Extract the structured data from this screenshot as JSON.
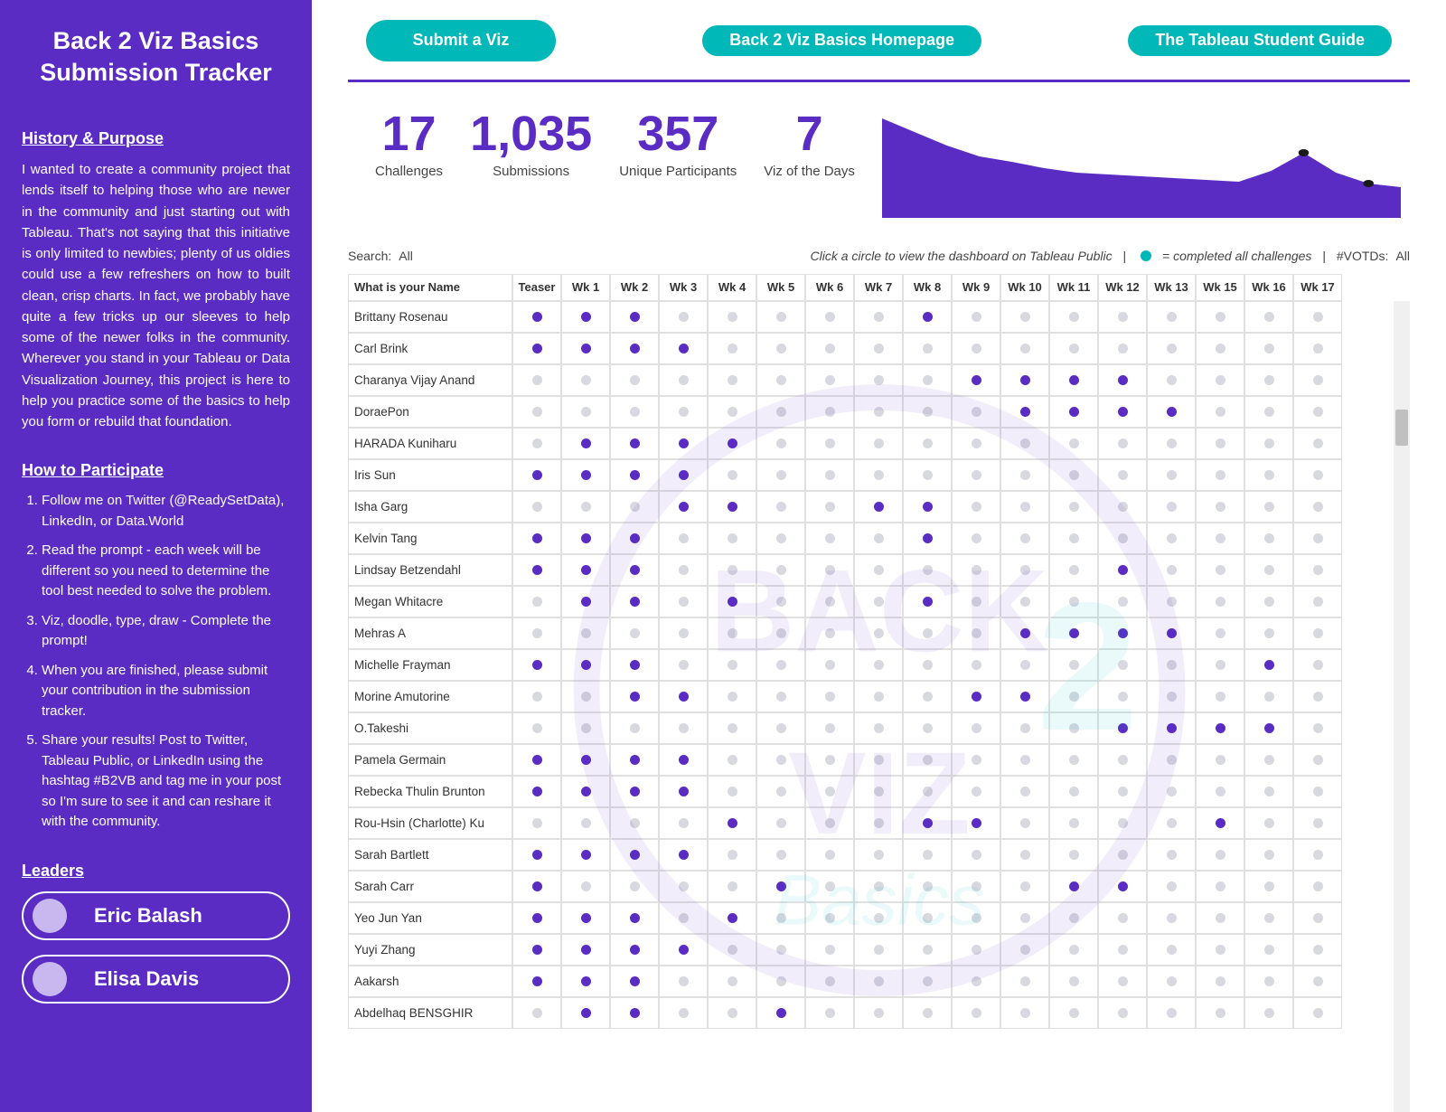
{
  "sidebar": {
    "title": "Back 2 Viz Basics Submission Tracker",
    "history_heading": "History & Purpose",
    "history_text": "I wanted to create a community project that lends itself to helping those who are newer in the community and just starting out with Tableau. That's not saying that this initiative is only limited to newbies; plenty of us oldies could use a few refreshers on how to built clean, crisp charts. In fact, we probably have quite a few tricks up our sleeves to help some of the newer folks in the community. Wherever you stand in your Tableau or Data Visualization Journey, this project is here to help you practice some of the basics to help you form or rebuild that foundation.",
    "participate_heading": "How to Participate",
    "participate_items": [
      "Follow me on Twitter (@ReadySetData), LinkedIn, or Data.World",
      "Read the prompt - each week will be different so you need to determine the tool best needed to solve the problem.",
      "Viz, doodle, type, draw - Complete the prompt!",
      "When you are finished, please submit your contribution in the submission tracker.",
      "Share your results! Post to Twitter, Tableau Public, or LinkedIn using the hashtag #B2VB and tag me in your post so I'm sure to see it and can reshare it with the community."
    ],
    "leaders_heading": "Leaders",
    "leaders": [
      "Eric Balash",
      "Elisa Davis"
    ]
  },
  "top": {
    "submit": "Submit a Viz",
    "homepage": "Back 2 Viz Basics Homepage",
    "guide": "The Tableau Student Guide"
  },
  "kpis": [
    {
      "value": "17",
      "label": "Challenges"
    },
    {
      "value": "1,035",
      "label": "Submissions"
    },
    {
      "value": "357",
      "label": "Unique Participants"
    },
    {
      "value": "7",
      "label": "Viz of the Days"
    }
  ],
  "filter": {
    "search_label": "Search:",
    "search_value": "All",
    "hint": "Click a circle to view the dashboard on Tableau Public",
    "legend_completed": "= completed all challenges",
    "votd_label": "#VOTDs:",
    "votd_value": "All"
  },
  "table": {
    "name_header": "What is your Name",
    "columns": [
      "Teaser",
      "Wk 1",
      "Wk 2",
      "Wk 3",
      "Wk 4",
      "Wk 5",
      "Wk 6",
      "Wk 7",
      "Wk 8",
      "Wk 9",
      "Wk 10",
      "Wk 11",
      "Wk 12",
      "Wk 13",
      "Wk 15",
      "Wk 16",
      "Wk 17"
    ],
    "rows": [
      {
        "name": "Brittany Rosenau",
        "cells": [
          1,
          1,
          1,
          0,
          0,
          0,
          0,
          0,
          1,
          0,
          0,
          0,
          0,
          0,
          0,
          0,
          0
        ]
      },
      {
        "name": "Carl Brink",
        "cells": [
          1,
          1,
          1,
          1,
          0,
          0,
          0,
          0,
          0,
          0,
          0,
          0,
          0,
          0,
          0,
          0,
          0
        ]
      },
      {
        "name": "Charanya Vijay Anand",
        "cells": [
          0,
          0,
          0,
          0,
          0,
          0,
          0,
          0,
          0,
          1,
          1,
          1,
          1,
          0,
          0,
          0,
          0
        ]
      },
      {
        "name": "DoraePon",
        "cells": [
          0,
          0,
          0,
          0,
          0,
          0,
          0,
          0,
          0,
          0,
          1,
          1,
          1,
          1,
          0,
          0,
          0
        ]
      },
      {
        "name": "HARADA Kuniharu",
        "cells": [
          0,
          1,
          1,
          1,
          1,
          0,
          0,
          0,
          0,
          0,
          0,
          0,
          0,
          0,
          0,
          0,
          0
        ]
      },
      {
        "name": "Iris Sun",
        "cells": [
          1,
          1,
          1,
          1,
          0,
          0,
          0,
          0,
          0,
          0,
          0,
          0,
          0,
          0,
          0,
          0,
          0
        ]
      },
      {
        "name": "Isha Garg",
        "cells": [
          0,
          0,
          0,
          1,
          1,
          0,
          0,
          1,
          1,
          0,
          0,
          0,
          0,
          0,
          0,
          0,
          0
        ]
      },
      {
        "name": "Kelvin Tang",
        "cells": [
          1,
          1,
          1,
          0,
          0,
          0,
          0,
          0,
          1,
          0,
          0,
          0,
          0,
          0,
          0,
          0,
          0
        ]
      },
      {
        "name": "Lindsay Betzendahl",
        "cells": [
          1,
          1,
          1,
          0,
          0,
          0,
          0,
          0,
          0,
          0,
          0,
          0,
          1,
          0,
          0,
          0,
          0
        ]
      },
      {
        "name": "Megan Whitacre",
        "cells": [
          0,
          1,
          1,
          0,
          1,
          0,
          0,
          0,
          1,
          0,
          0,
          0,
          0,
          0,
          0,
          0,
          0
        ]
      },
      {
        "name": "Mehras A",
        "cells": [
          0,
          0,
          0,
          0,
          0,
          0,
          0,
          0,
          0,
          0,
          1,
          1,
          1,
          1,
          0,
          0,
          0
        ]
      },
      {
        "name": "Michelle Frayman",
        "cells": [
          1,
          1,
          1,
          0,
          0,
          0,
          0,
          0,
          0,
          0,
          0,
          0,
          0,
          0,
          0,
          1,
          0
        ]
      },
      {
        "name": "Morine Amutorine",
        "cells": [
          0,
          0,
          1,
          1,
          0,
          0,
          0,
          0,
          0,
          1,
          1,
          0,
          0,
          0,
          0,
          0,
          0
        ]
      },
      {
        "name": "O.Takeshi",
        "cells": [
          0,
          0,
          0,
          0,
          0,
          0,
          0,
          0,
          0,
          0,
          0,
          0,
          1,
          1,
          1,
          1,
          0
        ]
      },
      {
        "name": "Pamela Germain",
        "cells": [
          1,
          1,
          1,
          1,
          0,
          0,
          0,
          0,
          0,
          0,
          0,
          0,
          0,
          0,
          0,
          0,
          0
        ]
      },
      {
        "name": "Rebecka Thulin Brunton",
        "cells": [
          1,
          1,
          1,
          1,
          0,
          0,
          0,
          0,
          0,
          0,
          0,
          0,
          0,
          0,
          0,
          0,
          0
        ]
      },
      {
        "name": "Rou-Hsin (Charlotte) Ku",
        "cells": [
          0,
          0,
          0,
          0,
          1,
          0,
          0,
          0,
          1,
          1,
          0,
          0,
          0,
          0,
          1,
          0,
          0
        ]
      },
      {
        "name": "Sarah Bartlett",
        "cells": [
          1,
          1,
          1,
          1,
          0,
          0,
          0,
          0,
          0,
          0,
          0,
          0,
          0,
          0,
          0,
          0,
          0
        ]
      },
      {
        "name": "Sarah Carr",
        "cells": [
          1,
          0,
          0,
          0,
          0,
          1,
          0,
          0,
          0,
          0,
          0,
          1,
          1,
          0,
          0,
          0,
          0
        ]
      },
      {
        "name": "Yeo Jun Yan",
        "cells": [
          1,
          1,
          1,
          0,
          1,
          0,
          0,
          0,
          0,
          0,
          0,
          0,
          0,
          0,
          0,
          0,
          0
        ]
      },
      {
        "name": "Yuyi Zhang",
        "cells": [
          1,
          1,
          1,
          1,
          0,
          0,
          0,
          0,
          0,
          0,
          0,
          0,
          0,
          0,
          0,
          0,
          0
        ]
      },
      {
        "name": "Aakarsh",
        "cells": [
          1,
          1,
          1,
          0,
          0,
          0,
          0,
          0,
          0,
          0,
          0,
          0,
          0,
          0,
          0,
          0,
          0
        ]
      },
      {
        "name": "Abdelhaq BENSGHIR",
        "cells": [
          0,
          1,
          1,
          0,
          0,
          1,
          0,
          0,
          0,
          0,
          0,
          0,
          0,
          0,
          0,
          0,
          0
        ]
      }
    ]
  },
  "chart_data": {
    "type": "area",
    "title": "",
    "xlabel": "",
    "ylabel": "",
    "categories": [
      "Teaser",
      "Wk 1",
      "Wk 2",
      "Wk 3",
      "Wk 4",
      "Wk 5",
      "Wk 6",
      "Wk 7",
      "Wk 8",
      "Wk 9",
      "Wk 10",
      "Wk 11",
      "Wk 12",
      "Wk 13",
      "Wk 15",
      "Wk 16",
      "Wk 17"
    ],
    "values": [
      110,
      95,
      80,
      68,
      62,
      55,
      50,
      48,
      46,
      44,
      42,
      40,
      52,
      72,
      50,
      38,
      34
    ],
    "ylim": [
      0,
      120
    ]
  }
}
